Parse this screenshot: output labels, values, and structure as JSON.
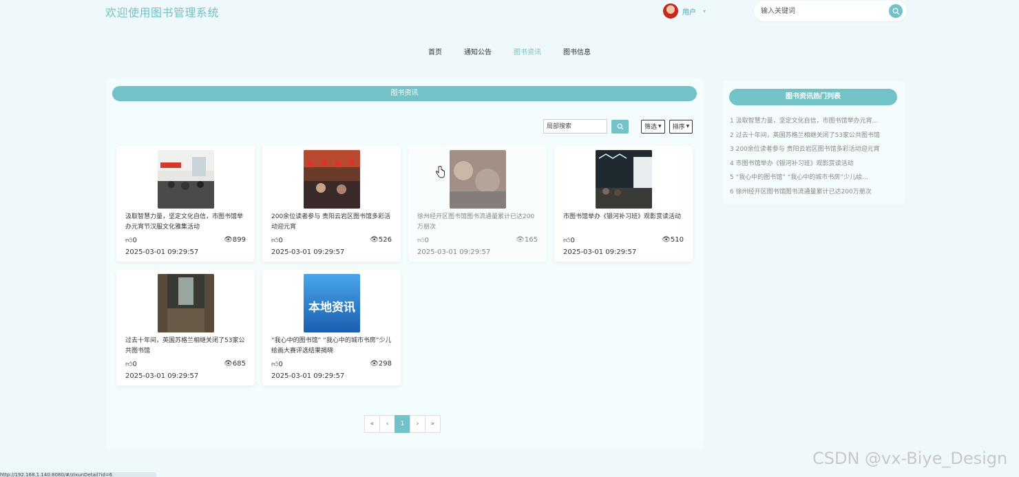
{
  "header": {
    "site_title": "欢迎使用图书管理系统",
    "user_label": "用户",
    "search_placeholder": "输入关键词"
  },
  "nav": {
    "items": [
      {
        "label": "首页",
        "active": false
      },
      {
        "label": "通知公告",
        "active": false
      },
      {
        "label": "图书资讯",
        "active": true
      },
      {
        "label": "图书信息",
        "active": false
      }
    ]
  },
  "main": {
    "title": "图书资讯",
    "local_search_placeholder": "局部搜索",
    "filter_label": "筛选",
    "sort_label": "排序"
  },
  "cards": [
    {
      "title": "汲取智慧力量，坚定文化自信，市图书馆举办元宵节汉服文化雅集活动",
      "likes": "0",
      "views": "899",
      "date": "2025-03-01 09:29:57"
    },
    {
      "title": "200余位读者参与 贵阳云岩区图书馆多彩活动迎元宵",
      "likes": "0",
      "views": "526",
      "date": "2025-03-01 09:29:57"
    },
    {
      "title": "徐州经开区图书馆图书流通量累计已达200万册次",
      "likes": "0",
      "views": "165",
      "date": "2025-03-01 09:29:57"
    },
    {
      "title": "市图书馆举办《银河补习班》观影赏读活动",
      "likes": "0",
      "views": "510",
      "date": "2025-03-01 09:29:57"
    },
    {
      "title": "过去十年间，英国苏格兰相继关闭了53家公共图书馆",
      "likes": "0",
      "views": "685",
      "date": "2025-03-01 09:29:57"
    },
    {
      "title": "“我心中的图书馆” “我心中的城市书房”少儿绘画大赛评选结果揭晓",
      "likes": "0",
      "views": "298",
      "date": "2025-03-01 09:29:57"
    }
  ],
  "pager": {
    "first": "«",
    "prev": "‹",
    "current": "1",
    "next": "›",
    "last": "»"
  },
  "sidebar": {
    "title": "图书资讯热门列表",
    "items": [
      "1  汲取智慧力量，坚定文化自信，市图书馆举办元宵...",
      "2  过去十年间，英国苏格兰相继关闭了53家公共图书馆",
      "3  200余位读者参与 贵阳云岩区图书馆多彩活动迎元宵",
      "4  市图书馆举办《银河补习班》观影赏读活动",
      "5  “我心中的图书馆” “我心中的城市书房”少儿绘...",
      "6  徐州经开区图书馆图书流通量累计已达200万册次"
    ]
  },
  "status_url": "http://192.168.1.140:8080/#/zixunDetail?id=6",
  "watermark": "CSDN @vx-Biye_Design",
  "thumb_badge": "本地资讯",
  "colors": {
    "accent": "#73c2c8",
    "page_bg": "#eff9fb"
  }
}
